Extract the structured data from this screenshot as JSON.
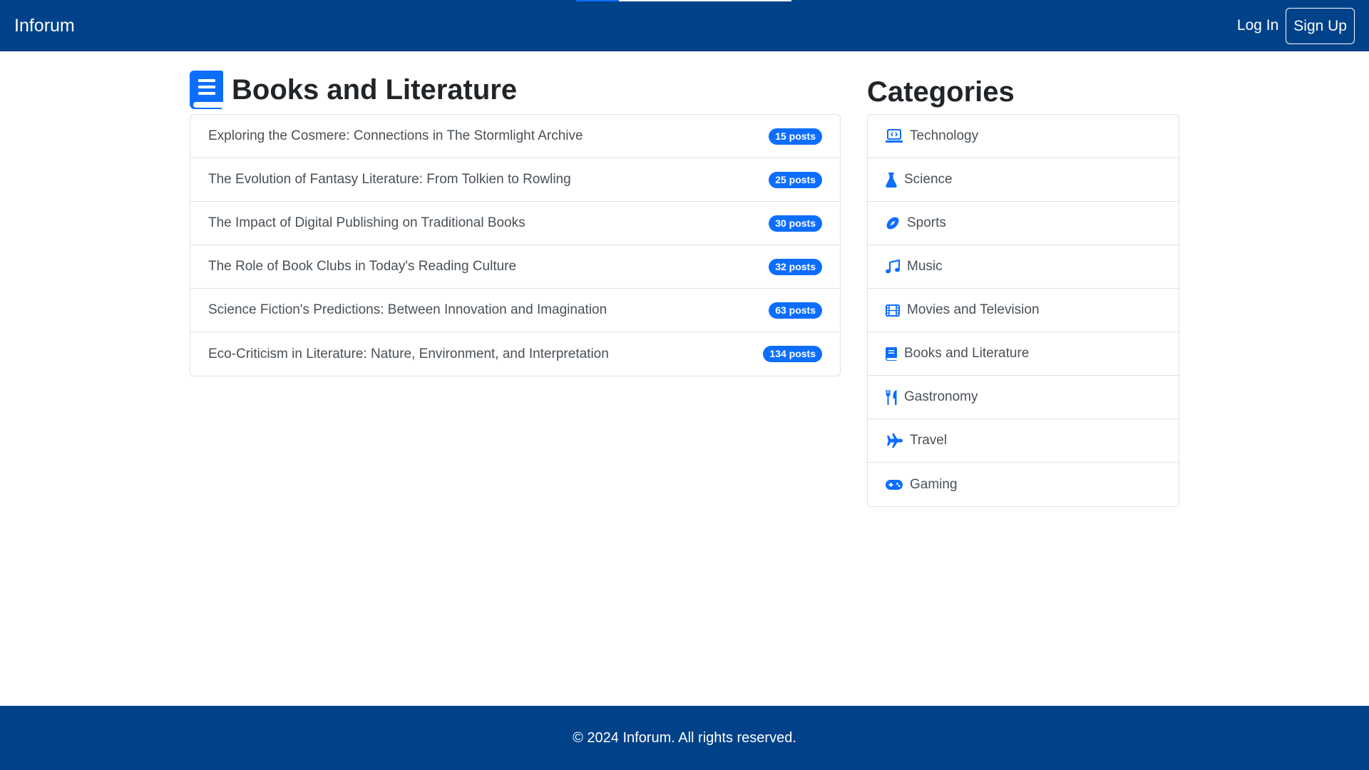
{
  "app": {
    "brand": "Inforum",
    "colors": {
      "navbar": "#004289",
      "accent": "#0d6efd",
      "footer": "#004289"
    }
  },
  "nav": {
    "login_label": "Log In",
    "signup_label": "Sign Up",
    "load_progress": 0.2
  },
  "main": {
    "title": "Books and Literature",
    "title_icon": "book-icon",
    "topics": [
      {
        "title": "Exploring the Cosmere: Connections in The Stormlight Archive",
        "badge": "15 posts"
      },
      {
        "title": "The Evolution of Fantasy Literature: From Tolkien to Rowling",
        "badge": "25 posts"
      },
      {
        "title": "The Impact of Digital Publishing on Traditional Books",
        "badge": "30 posts"
      },
      {
        "title": "The Role of Book Clubs in Today's Reading Culture",
        "badge": "32 posts"
      },
      {
        "title": "Science Fiction's Predictions: Between Innovation and Imagination",
        "badge": "63 posts"
      },
      {
        "title": "Eco-Criticism in Literature: Nature, Environment, and Interpretation",
        "badge": "134 posts"
      }
    ]
  },
  "sidebar": {
    "title": "Categories",
    "categories": [
      {
        "label": "Technology",
        "icon": "laptop-code-icon"
      },
      {
        "label": "Science",
        "icon": "flask-icon"
      },
      {
        "label": "Sports",
        "icon": "football-icon"
      },
      {
        "label": "Music",
        "icon": "music-icon"
      },
      {
        "label": "Movies and Television",
        "icon": "film-icon"
      },
      {
        "label": "Books and Literature",
        "icon": "book-icon"
      },
      {
        "label": "Gastronomy",
        "icon": "utensils-icon"
      },
      {
        "label": "Travel",
        "icon": "plane-icon"
      },
      {
        "label": "Gaming",
        "icon": "gamepad-icon"
      }
    ]
  },
  "footer": {
    "text": "© 2024 Inforum. All rights reserved."
  }
}
